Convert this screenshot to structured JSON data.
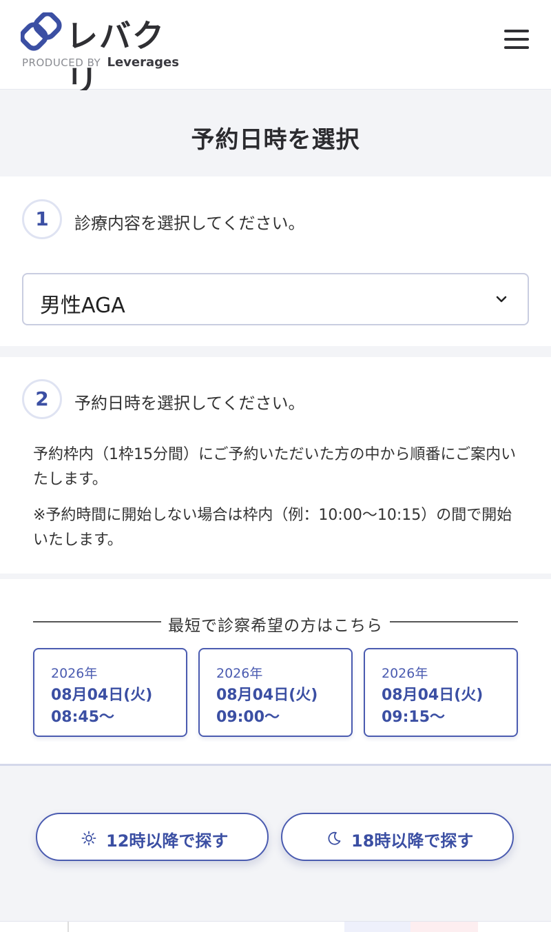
{
  "header": {
    "logo_text": "レバクリ",
    "logo_sub_prefix": "PRODUCED BY",
    "logo_sub_brand": "Leverages",
    "brand_color": "#3b4fa3"
  },
  "page": {
    "title": "予約日時を選択"
  },
  "step1": {
    "number": "1",
    "label": "診療内容を選択してください。",
    "select_value": "男性AGA"
  },
  "step2": {
    "number": "2",
    "label": "予約日時を選択してください。",
    "notice1": "予約枠内（1枠15分間）にご予約いただいた方の中から順番にご案内いたします。",
    "notice2": "※予約時間に開始しない場合は枠内（例：10:00〜10:15）の間で開始いたします。"
  },
  "quick": {
    "heading": "最短で診察希望の方はこちら",
    "slots": [
      {
        "year": "2026年",
        "date": "08月04日(火)",
        "time": "08:45〜"
      },
      {
        "year": "2026年",
        "date": "08月04日(火)",
        "time": "09:00〜"
      },
      {
        "year": "2026年",
        "date": "08月04日(火)",
        "time": "09:15〜"
      }
    ]
  },
  "filters": {
    "afternoon_label": "12時以降で探す",
    "afternoon_icon": "sun-icon",
    "evening_label": "18時以降で探す",
    "evening_icon": "moon-icon"
  }
}
